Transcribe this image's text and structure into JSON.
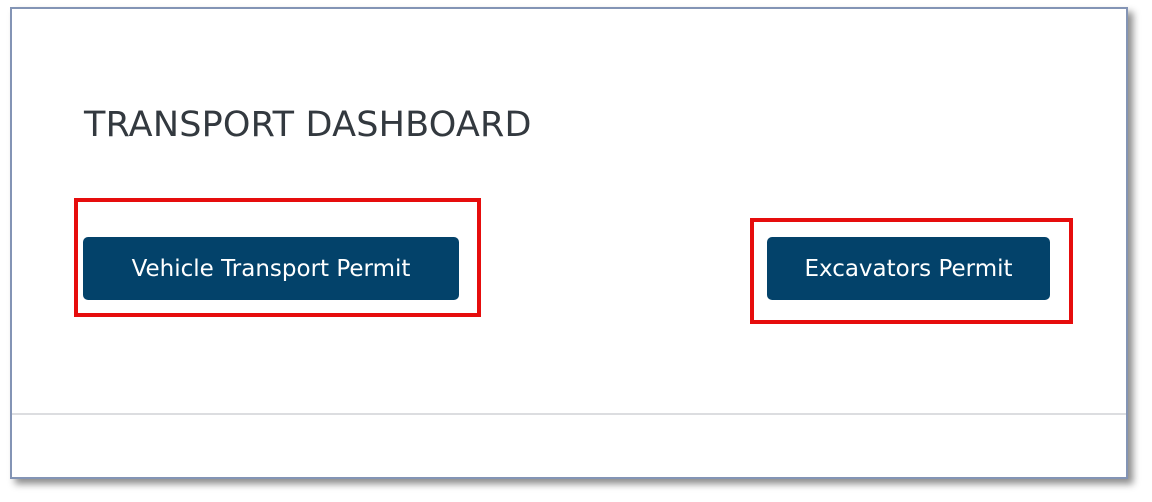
{
  "dashboard": {
    "title": "TRANSPORT DASHBOARD"
  },
  "actions": {
    "vehicle_transport_permit_label": "Vehicle Transport Permit",
    "excavators_permit_label": "Excavators Permit"
  },
  "colors": {
    "button_background": "#03426a",
    "button_text": "#ffffff",
    "highlight_border": "#e60d0d",
    "title_text": "#33393f",
    "frame_border": "#8394b5",
    "divider": "#dcdde0"
  }
}
